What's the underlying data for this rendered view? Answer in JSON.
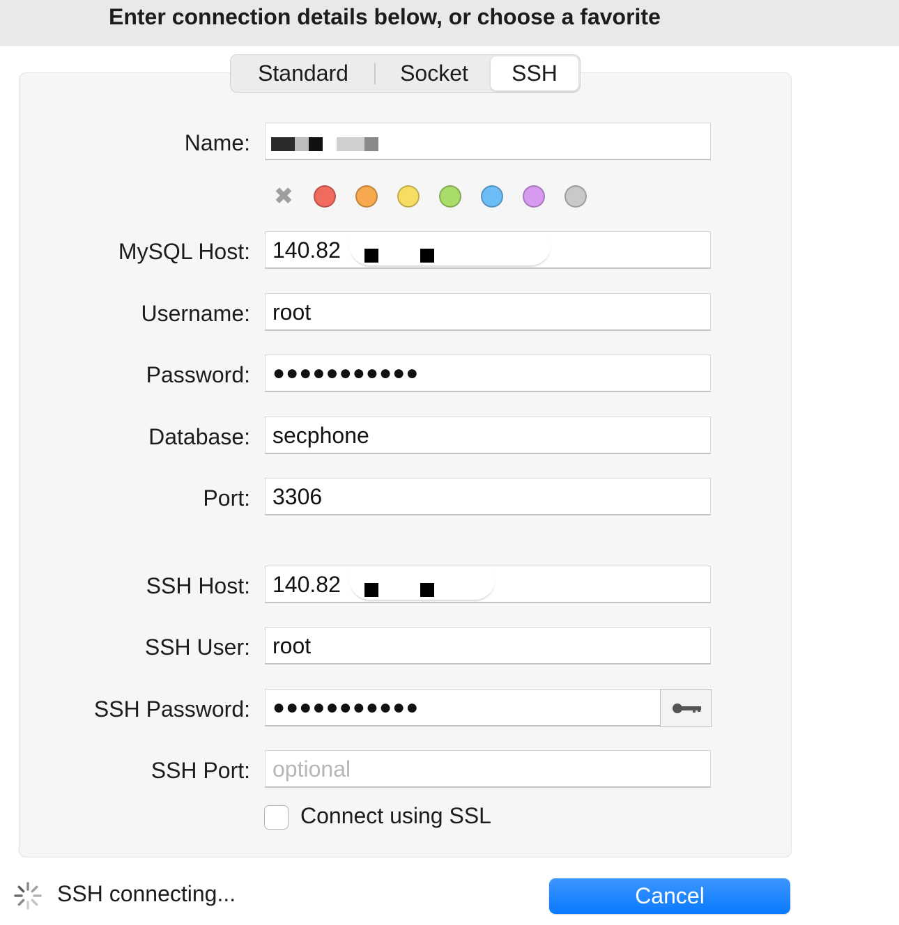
{
  "header": {
    "title": "Enter connection details below, or choose a favorite"
  },
  "tabs": {
    "standard": "Standard",
    "socket": "Socket",
    "ssh": "SSH",
    "selected": "SSH"
  },
  "form": {
    "name": {
      "label": "Name:",
      "value": ""
    },
    "colors": [
      "#f06a5d",
      "#f7a94f",
      "#f7dd63",
      "#a9dc6a",
      "#6cbdf6",
      "#d79af0",
      "#c9c9c9"
    ],
    "mysql_host": {
      "label": "MySQL Host:",
      "value": "140.82"
    },
    "username": {
      "label": "Username:",
      "value": "root"
    },
    "password": {
      "label": "Password:",
      "value": "●●●●●●●●●●●"
    },
    "database": {
      "label": "Database:",
      "value": "secphone"
    },
    "port": {
      "label": "Port:",
      "value": "3306"
    },
    "ssh_host": {
      "label": "SSH Host:",
      "value": "140.82"
    },
    "ssh_user": {
      "label": "SSH User:",
      "value": "root"
    },
    "ssh_password": {
      "label": "SSH Password:",
      "value": "●●●●●●●●●●●"
    },
    "ssh_port": {
      "label": "SSH Port:",
      "placeholder": "optional"
    },
    "ssl": {
      "label": "Connect using SSL",
      "checked": false
    }
  },
  "footer": {
    "status": "SSH connecting...",
    "cancel_label": "Cancel",
    "accent": "#0a7aff"
  }
}
